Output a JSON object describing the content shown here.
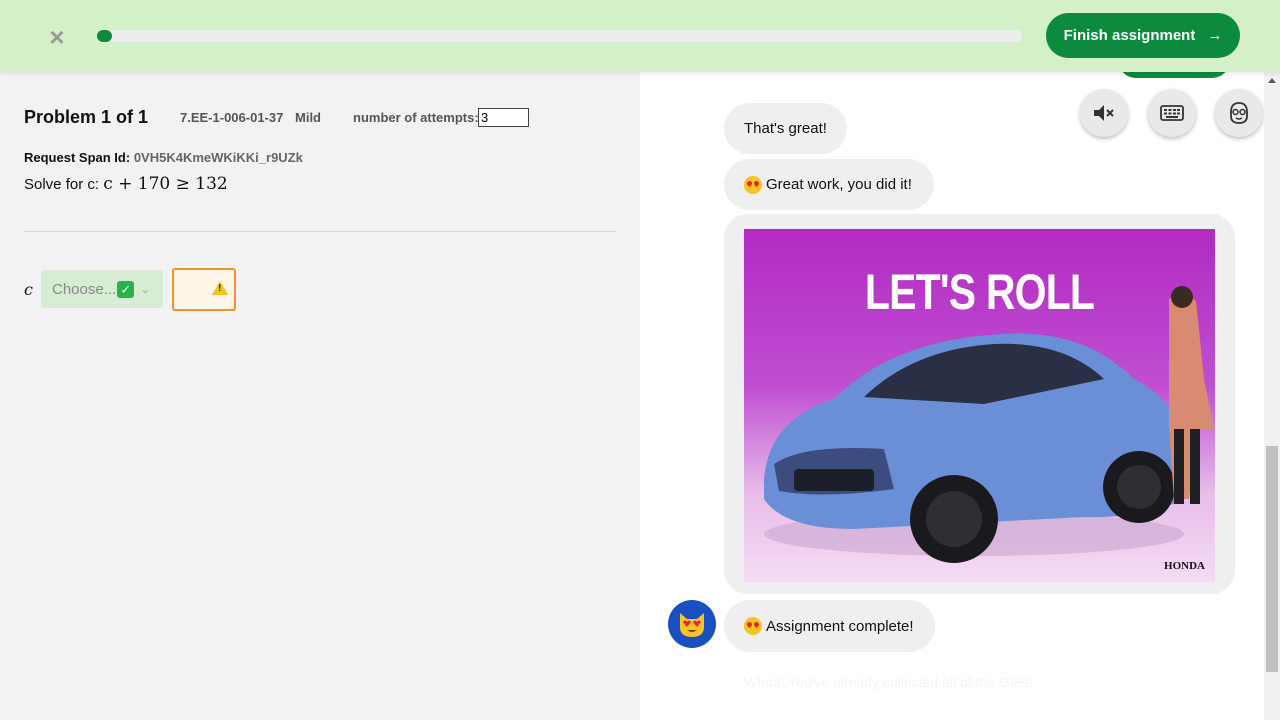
{
  "topbar": {
    "close_label": "×",
    "progress_value": 0.016,
    "finish_label": "Finish assignment",
    "finish_arrow": "→"
  },
  "problem": {
    "title": "Problem 1 of 1",
    "code": "7.EE-1-006-01-37",
    "difficulty": "Mild",
    "attempts_label": "number of attempts:",
    "attempts_value": "3",
    "span_label": "Request Span Id:",
    "span_value": "0VH5K4KmeWKiKKi_r9UZk",
    "solve_prefix": "Solve for c:",
    "equation": "c + 170 ≥ 132",
    "variable": "c",
    "choose_placeholder": "Choose...",
    "check_symbol": "✓",
    "chevron": "⌄"
  },
  "chat": {
    "messages": [
      {
        "text": "That's great!"
      },
      {
        "text": "Great work, you did it!"
      },
      {
        "text": "Assignment complete!"
      }
    ],
    "gif_text": "LET'S ROLL",
    "gif_brand": "HONDA",
    "ghost_text": "Whoa! You've already collected all of the GIFs!"
  },
  "tools": [
    "mute-icon",
    "keyboard-icon",
    "robot-face-icon"
  ],
  "colors": {
    "topbar_bg": "#d4f0c9",
    "primary_green": "#0c8a3e",
    "left_bg": "#f2f2f4",
    "bubble_bg": "#efeff1",
    "warning_orange": "#f0922d"
  }
}
